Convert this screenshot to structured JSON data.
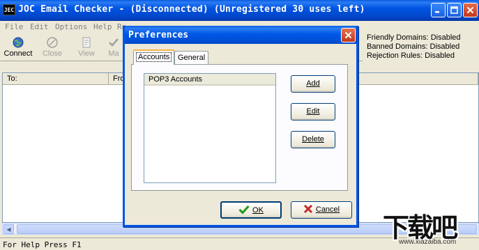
{
  "window": {
    "app_icon": "JEC",
    "title": "JOC Email Checker - (Disconnected) (Unregistered 30 uses left)"
  },
  "menu": [
    "File",
    "Edit",
    "Options",
    "Help",
    "Re"
  ],
  "toolbar": {
    "connect": "Connect",
    "close": "Close",
    "view": "View",
    "mark": "Ma"
  },
  "status_info": {
    "friendly": "Friendly Domains: Disabled",
    "banned": "Banned Domains: Disabled",
    "rejection": "Rejection Rules: Disabled"
  },
  "columns": {
    "to": "To:",
    "from": "Fro"
  },
  "statusbar": "For Help Press F1",
  "dialog": {
    "title": "Preferences",
    "tabs": [
      "Accounts",
      "General"
    ],
    "list_header": "POP3 Accounts",
    "add": "Add",
    "edit": "Edit",
    "delete": "Delete",
    "ok": "OK",
    "cancel": "Cancel"
  },
  "watermark": {
    "logo": "下载吧",
    "url": "www.xiazaiba.com"
  }
}
